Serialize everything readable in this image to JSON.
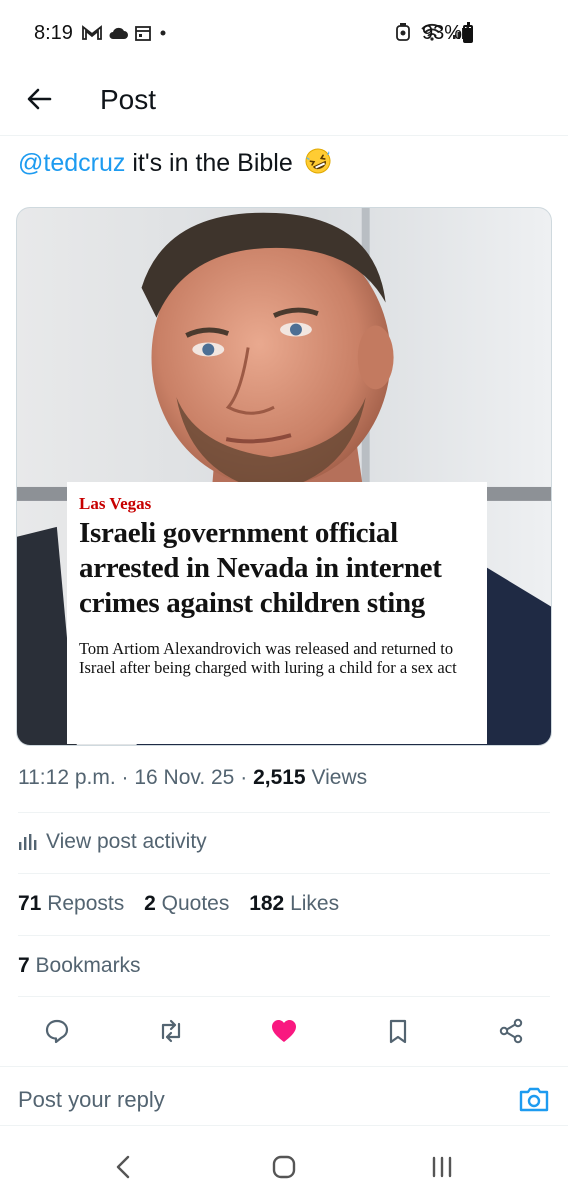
{
  "status_bar": {
    "time": "8:19",
    "battery_text": "93%",
    "battery_level": 0.93,
    "icons": [
      "gmail-icon",
      "cloud-icon",
      "calendar-icon",
      "dot-icon",
      "recycle-icon",
      "wifi-icon",
      "signal-icon",
      "battery-icon"
    ]
  },
  "header": {
    "back_icon": "arrow-left-icon",
    "title": "Post"
  },
  "post": {
    "mention": "@tedcruz",
    "text": "it's in the Bible",
    "emoji": "rofl-emoji"
  },
  "media": {
    "kicker": "Las Vegas",
    "headline": "Israeli government official arrested in Nevada in internet crimes against children sting",
    "standfirst": "Tom Artiom Alexandrovich was released and returned to Israel after being charged with luring a child for a sex act"
  },
  "meta": {
    "time": "11:12 p.m.",
    "date": "16 Nov. 25",
    "separator": "·",
    "views_count": "2,515",
    "views_label": "Views"
  },
  "activity": {
    "icon": "bar-chart-icon",
    "label": "View post activity"
  },
  "stats": {
    "reposts_count": "71",
    "reposts_label": "Reposts",
    "quotes_count": "2",
    "quotes_label": "Quotes",
    "likes_count": "182",
    "likes_label": "Likes",
    "bookmarks_count": "7",
    "bookmarks_label": "Bookmarks"
  },
  "actions": {
    "icons": [
      "reply-icon",
      "repost-icon",
      "like-icon",
      "bookmark-icon",
      "share-icon"
    ],
    "liked": true,
    "like_color": "#f91880"
  },
  "reply": {
    "placeholder": "Post your reply",
    "camera_icon": "camera-icon",
    "accent": "#1d9bf0"
  },
  "nav": {
    "icons": [
      "nav-back-icon",
      "nav-home-icon",
      "nav-recents-icon"
    ]
  }
}
